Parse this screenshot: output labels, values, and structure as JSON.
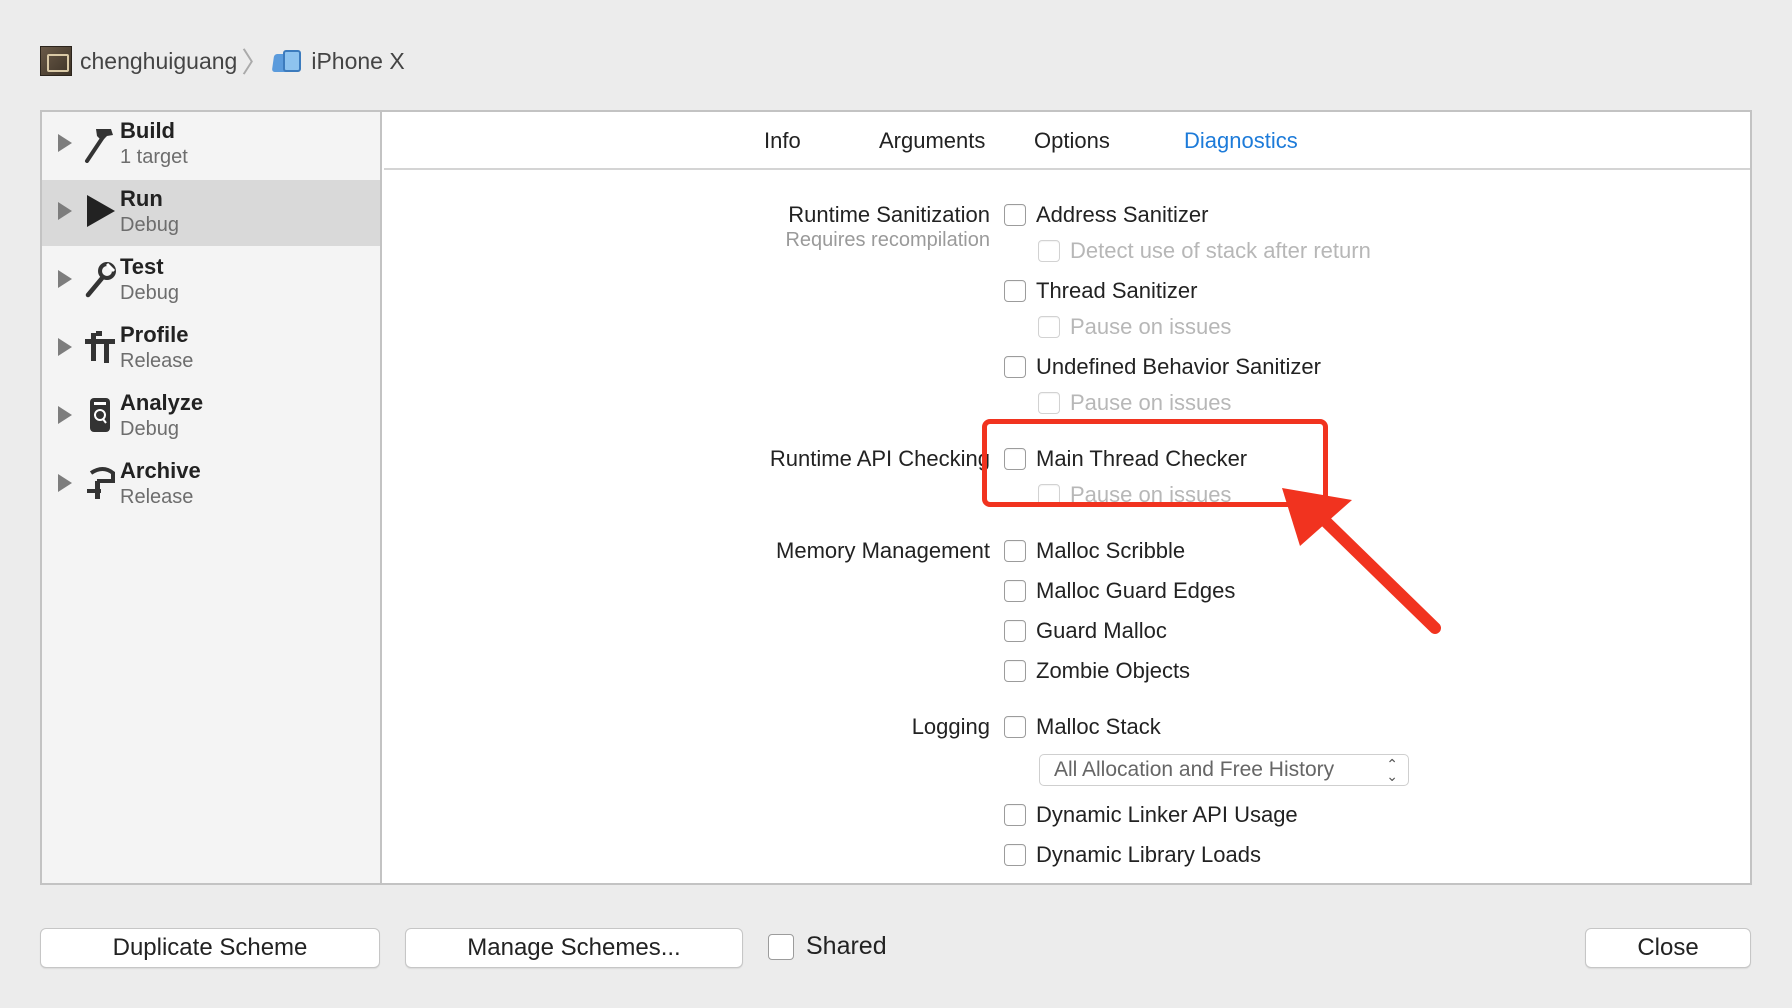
{
  "breadcrumb": {
    "project": "chenghuiguang",
    "separator": "〉",
    "device": "iPhone X"
  },
  "sidebar": {
    "items": [
      {
        "title": "Build",
        "subtitle": "1 target",
        "icon": "hammer-icon",
        "selected": false
      },
      {
        "title": "Run",
        "subtitle": "Debug",
        "icon": "play-icon",
        "selected": true
      },
      {
        "title": "Test",
        "subtitle": "Debug",
        "icon": "wrench-icon",
        "selected": false
      },
      {
        "title": "Profile",
        "subtitle": "Release",
        "icon": "instruments-icon",
        "selected": false
      },
      {
        "title": "Analyze",
        "subtitle": "Debug",
        "icon": "analyze-icon",
        "selected": false
      },
      {
        "title": "Archive",
        "subtitle": "Release",
        "icon": "archive-icon",
        "selected": false
      }
    ]
  },
  "tabs": {
    "items": [
      "Info",
      "Arguments",
      "Options",
      "Diagnostics"
    ],
    "active": "Diagnostics"
  },
  "sections": {
    "runtime_sanitization": {
      "label": "Runtime Sanitization",
      "note": "Requires recompilation",
      "options": [
        {
          "label": "Address Sanitizer",
          "checked": false,
          "enabled": true
        },
        {
          "label": "Detect use of stack after return",
          "checked": false,
          "enabled": false
        },
        {
          "label": "Thread Sanitizer",
          "checked": false,
          "enabled": true
        },
        {
          "label": "Pause on issues",
          "checked": false,
          "enabled": false
        },
        {
          "label": "Undefined Behavior Sanitizer",
          "checked": false,
          "enabled": true
        },
        {
          "label": "Pause on issues",
          "checked": false,
          "enabled": false
        }
      ]
    },
    "runtime_api_checking": {
      "label": "Runtime API Checking",
      "options": [
        {
          "label": "Main Thread Checker",
          "checked": false,
          "enabled": true
        },
        {
          "label": "Pause on issues",
          "checked": false,
          "enabled": false
        }
      ]
    },
    "memory_management": {
      "label": "Memory Management",
      "options": [
        {
          "label": "Malloc Scribble",
          "checked": false,
          "enabled": true
        },
        {
          "label": "Malloc Guard Edges",
          "checked": false,
          "enabled": true
        },
        {
          "label": "Guard Malloc",
          "checked": false,
          "enabled": true
        },
        {
          "label": "Zombie Objects",
          "checked": false,
          "enabled": true
        }
      ]
    },
    "logging": {
      "label": "Logging",
      "options": [
        {
          "label": "Malloc Stack",
          "checked": false,
          "enabled": true
        },
        {
          "label": "Dynamic Linker API Usage",
          "checked": false,
          "enabled": true
        },
        {
          "label": "Dynamic Library Loads",
          "checked": false,
          "enabled": true
        }
      ],
      "malloc_stack_mode": {
        "value": "All Allocation and Free History",
        "arrows": "⌃⌄"
      }
    }
  },
  "footer": {
    "duplicate_label": "Duplicate Scheme",
    "manage_label": "Manage Schemes...",
    "shared_label": "Shared",
    "shared_checked": false,
    "close_label": "Close"
  },
  "annotation": {
    "highlight_color": "#f1331f",
    "target": "Main Thread Checker"
  },
  "colors": {
    "accent": "#1d7bd9",
    "selected_row": "#d9d9d9"
  }
}
